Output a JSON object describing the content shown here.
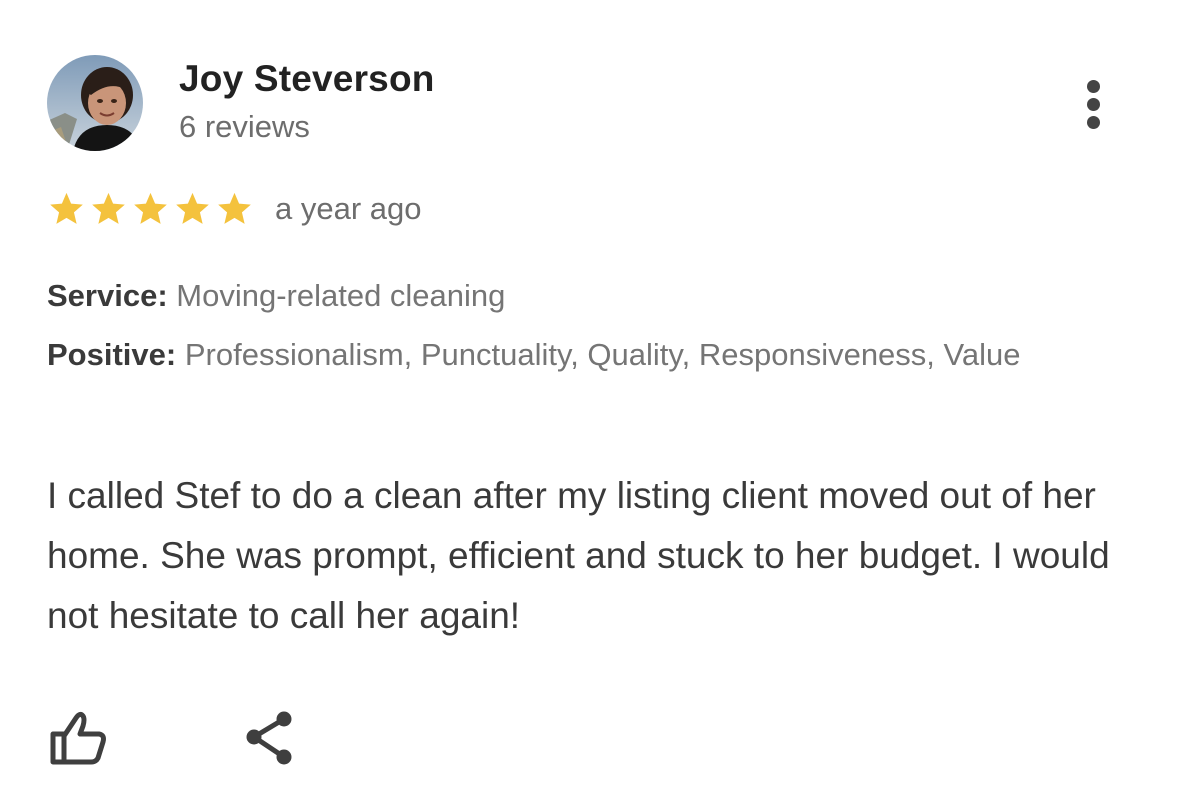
{
  "review": {
    "author": {
      "name": "Joy Steverson",
      "review_count": "6 reviews",
      "avatar_icon": "user-photo"
    },
    "rating": 5,
    "rating_max": 5,
    "star_color": "#f4c23d",
    "time_ago": "a year ago",
    "service": {
      "label": "Service:",
      "value": "Moving-related cleaning"
    },
    "positive": {
      "label": "Positive:",
      "value": "Professionalism, Punctuality, Quality, Responsiveness, Value"
    },
    "text": "I called Stef to do a clean after my listing client moved out of her home. She was prompt, efficient and stuck to her budget. I would not hesitate to call her again!",
    "actions": {
      "like_icon": "thumbs-up-icon",
      "share_icon": "share-icon",
      "more_icon": "more-vertical-icon"
    }
  }
}
